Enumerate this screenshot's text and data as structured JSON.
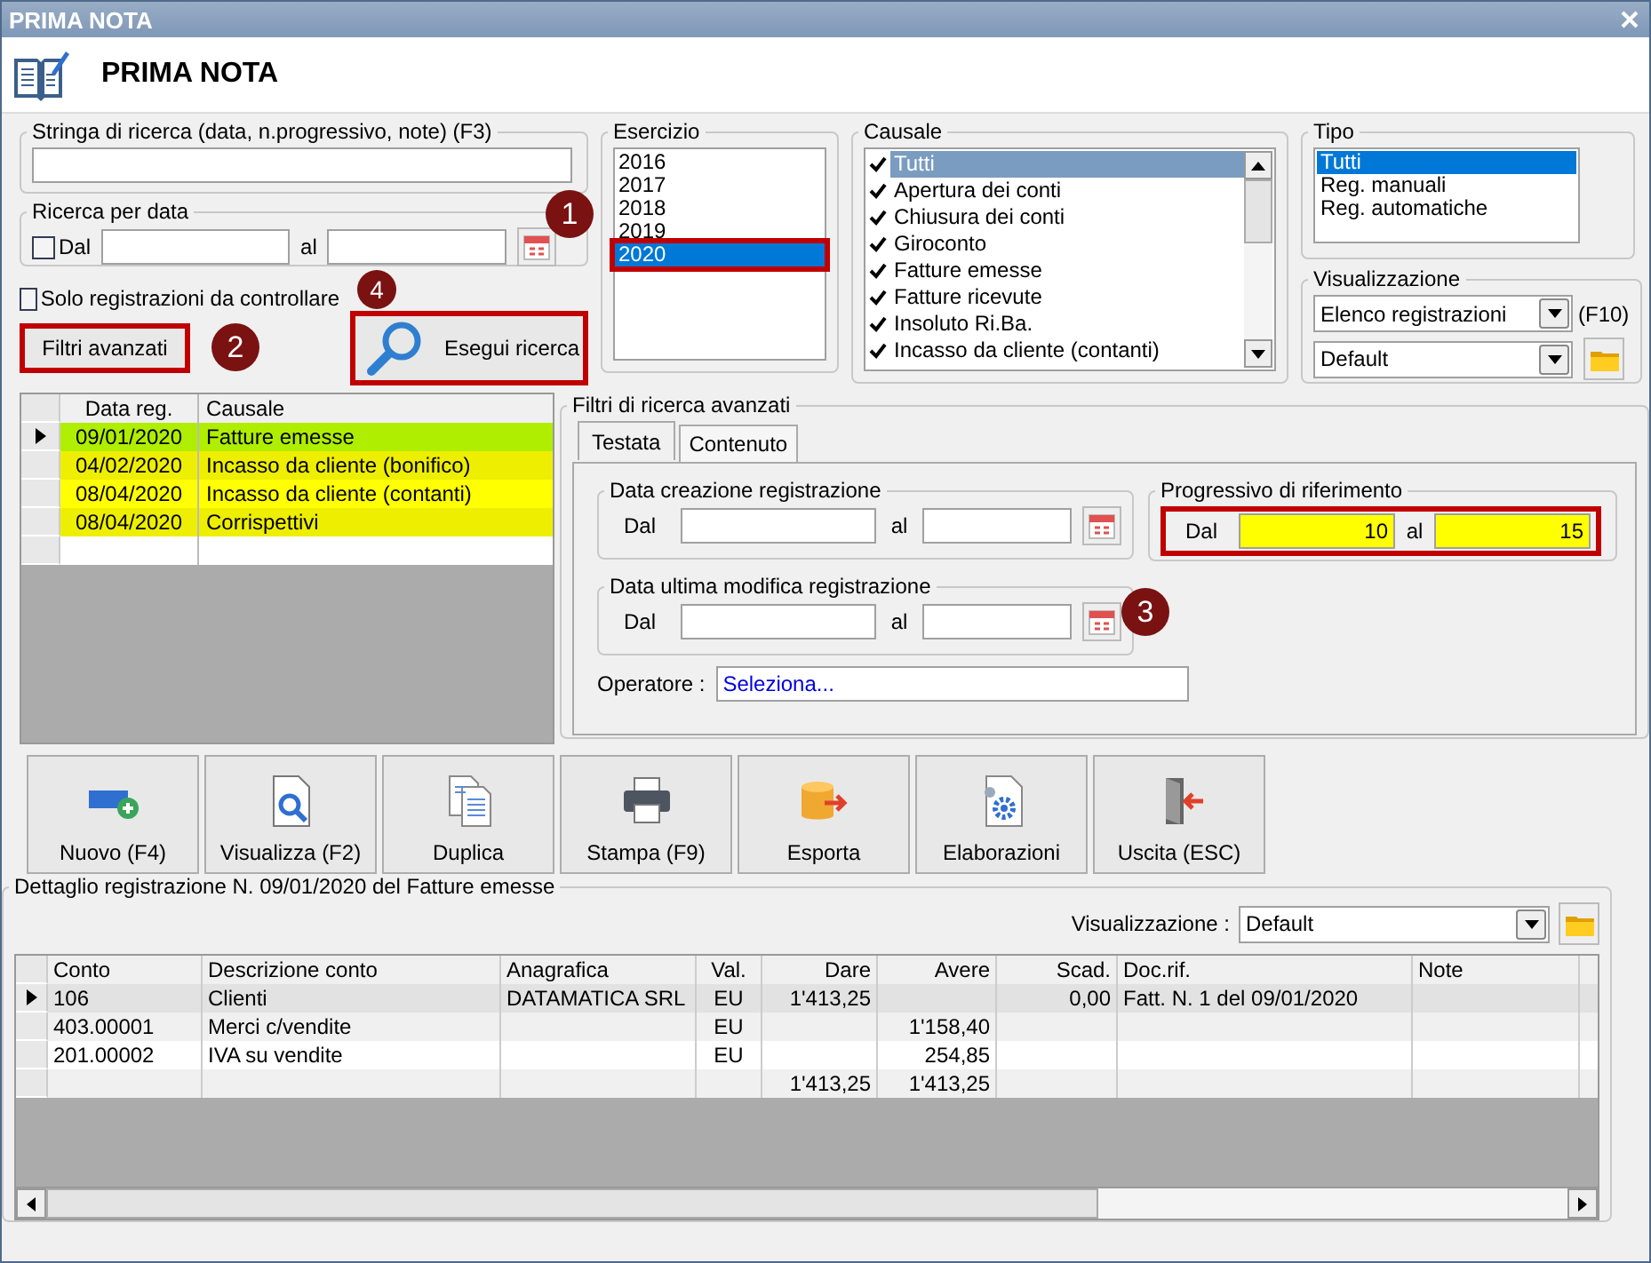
{
  "window": {
    "title": "PRIMA NOTA"
  },
  "header": {
    "title": "PRIMA NOTA"
  },
  "search": {
    "label": "Stringa di ricerca (data, n.progressivo, note) (F3)"
  },
  "date_search": {
    "label": "Ricerca per data",
    "checkbox": {
      "label": "Dal",
      "checked": false
    },
    "to_label": "al"
  },
  "only_to_check": {
    "label": "Solo registrazioni da controllare",
    "checked": false
  },
  "advanced_button": {
    "label": "Filtri avanzati",
    "highlighted": true,
    "marker": "2"
  },
  "search_button": {
    "label": "Esegui ricerca",
    "highlighted": true,
    "marker": "4"
  },
  "esercizio": {
    "label": "Esercizio",
    "marker": "1",
    "items": [
      {
        "label": "2016",
        "selected": false,
        "highlighted": false
      },
      {
        "label": "2017",
        "selected": false,
        "highlighted": false
      },
      {
        "label": "2018",
        "selected": false,
        "highlighted": false
      },
      {
        "label": "2019",
        "selected": false,
        "highlighted": false
      },
      {
        "label": "2020",
        "selected": true,
        "highlighted": true
      }
    ]
  },
  "causale": {
    "label": "Causale",
    "items": [
      {
        "label": "Tutti",
        "checked": true,
        "selected": true
      },
      {
        "label": "Apertura dei conti",
        "checked": true,
        "selected": false
      },
      {
        "label": "Chiusura dei conti",
        "checked": true,
        "selected": false
      },
      {
        "label": "Giroconto",
        "checked": true,
        "selected": false
      },
      {
        "label": "Fatture emesse",
        "checked": true,
        "selected": false
      },
      {
        "label": "Fatture ricevute",
        "checked": true,
        "selected": false
      },
      {
        "label": "Insoluto Ri.Ba.",
        "checked": true,
        "selected": false
      },
      {
        "label": "Incasso da cliente (contanti)",
        "checked": true,
        "selected": false
      }
    ]
  },
  "tipo": {
    "label": "Tipo",
    "items": [
      {
        "label": "Tutti",
        "selected": true
      },
      {
        "label": "Reg. manuali",
        "selected": false
      },
      {
        "label": "Reg. automatiche",
        "selected": false
      }
    ]
  },
  "visualizzazione": {
    "label": "Visualizzazione",
    "view": "Elenco registrazioni",
    "shortcut": "(F10)",
    "layout": "Default"
  },
  "records": {
    "columns": [
      "Data reg.",
      "Causale"
    ],
    "rows": [
      {
        "date": "09/01/2020",
        "causale": "Fatture emesse",
        "color": "#b0ee00",
        "current": true
      },
      {
        "date": "04/02/2020",
        "causale": "Incasso da cliente (bonifico)",
        "color": "#eeee00",
        "current": false
      },
      {
        "date": "08/04/2020",
        "causale": "Incasso da cliente (contanti)",
        "color": "#ffff00",
        "current": false
      },
      {
        "date": "08/04/2020",
        "causale": "Corrispettivi",
        "color": "#eeee00",
        "current": false
      }
    ]
  },
  "advanced_filters": {
    "label": "Filtri di ricerca avanzati",
    "tabs": [
      {
        "label": "Testata",
        "selected": true
      },
      {
        "label": "Contenuto",
        "selected": false
      }
    ],
    "date_groups": [
      {
        "label": "Data creazione registrazione",
        "from_label": "Dal",
        "to_label": "al"
      },
      {
        "label": "Data ultima modifica registrazione",
        "from_label": "Dal",
        "to_label": "al"
      }
    ],
    "progressive": {
      "label": "Progressivo di riferimento",
      "from_label": "Dal",
      "from_value": "10",
      "to_label": "al",
      "to_value": "15",
      "highlighted": true,
      "marker": "3"
    },
    "operator": {
      "label": "Operatore :",
      "value": "Seleziona..."
    }
  },
  "toolbar": [
    {
      "label": "Nuovo (F4)",
      "kind": "new"
    },
    {
      "label": "Visualizza (F2)",
      "kind": "view"
    },
    {
      "label": "Duplica",
      "kind": "duplicate"
    },
    {
      "label": "Stampa (F9)",
      "kind": "print"
    },
    {
      "label": "Esporta",
      "kind": "export"
    },
    {
      "label": "Elaborazioni",
      "kind": "process"
    },
    {
      "label": "Uscita (ESC)",
      "kind": "exit"
    }
  ],
  "detail": {
    "label": "Dettaglio registrazione N. 09/01/2020 del Fatture emesse",
    "view_label": "Visualizzazione :",
    "view_value": "Default",
    "columns": [
      "Conto",
      "Descrizione conto",
      "Anagrafica",
      "Val.",
      "Dare",
      "Avere",
      "Scad.",
      "Doc.rif.",
      "Note"
    ],
    "rows": [
      {
        "current": true,
        "cells": [
          "106",
          "Clienti",
          "DATAMATICA SRL",
          "EU",
          "1'413,25",
          null,
          "0,00",
          "Fatt. N. 1 del 09/01/2020",
          null
        ]
      },
      {
        "current": false,
        "cells": [
          "403.00001",
          "Merci c/vendite",
          null,
          "EU",
          null,
          "1'158,40",
          null,
          null,
          null
        ]
      },
      {
        "current": false,
        "cells": [
          "201.00002",
          "IVA su vendite",
          null,
          "EU",
          null,
          "254,85",
          null,
          null,
          null
        ]
      },
      {
        "current": false,
        "cells": [
          null,
          null,
          null,
          null,
          "1'413,25",
          "1'413,25",
          null,
          null,
          null
        ]
      }
    ]
  }
}
